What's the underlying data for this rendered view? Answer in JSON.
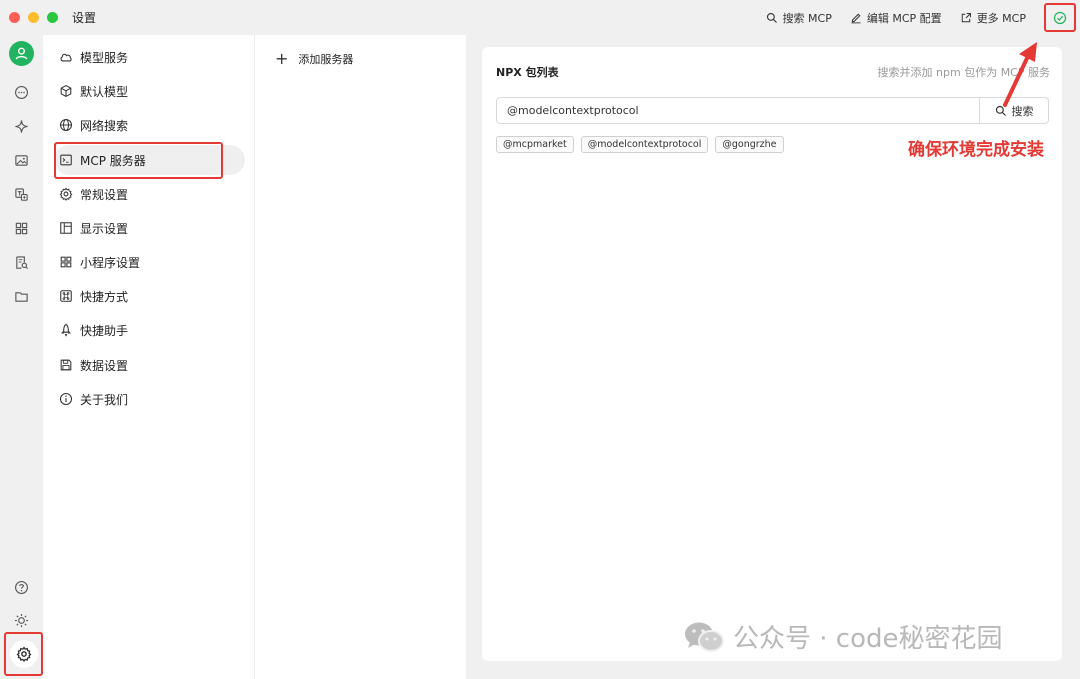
{
  "window": {
    "title": "设置"
  },
  "toolbar": {
    "search_mcp": "搜索 MCP",
    "edit_mcp_config": "编辑 MCP 配置",
    "more_mcp": "更多 MCP"
  },
  "nav": {
    "items": [
      {
        "label": "模型服务",
        "icon": "cloud-icon"
      },
      {
        "label": "默认模型",
        "icon": "cube-icon"
      },
      {
        "label": "网络搜索",
        "icon": "globe-icon"
      },
      {
        "label": "MCP 服务器",
        "icon": "terminal-icon"
      },
      {
        "label": "常规设置",
        "icon": "gear-icon"
      },
      {
        "label": "显示设置",
        "icon": "layout-icon"
      },
      {
        "label": "小程序设置",
        "icon": "grid-icon"
      },
      {
        "label": "快捷方式",
        "icon": "command-icon"
      },
      {
        "label": "快捷助手",
        "icon": "rocket-icon"
      },
      {
        "label": "数据设置",
        "icon": "save-icon"
      },
      {
        "label": "关于我们",
        "icon": "info-icon"
      }
    ],
    "active": "MCP 服务器"
  },
  "servers": {
    "add_label": "添加服务器"
  },
  "npx": {
    "title": "NPX 包列表",
    "hint": "搜索并添加 npm 包作为 MCP 服务",
    "search_value": "@modelcontextprotocol",
    "search_button": "搜索",
    "tags": [
      "@mcpmarket",
      "@modelcontextprotocol",
      "@gongrzhe"
    ]
  },
  "annotation": {
    "text": "确保环境完成安装"
  },
  "watermark": {
    "text": "公众号 · code秘密花园"
  },
  "colors": {
    "accent_green": "#21b35f",
    "highlight_red": "#e53935"
  }
}
